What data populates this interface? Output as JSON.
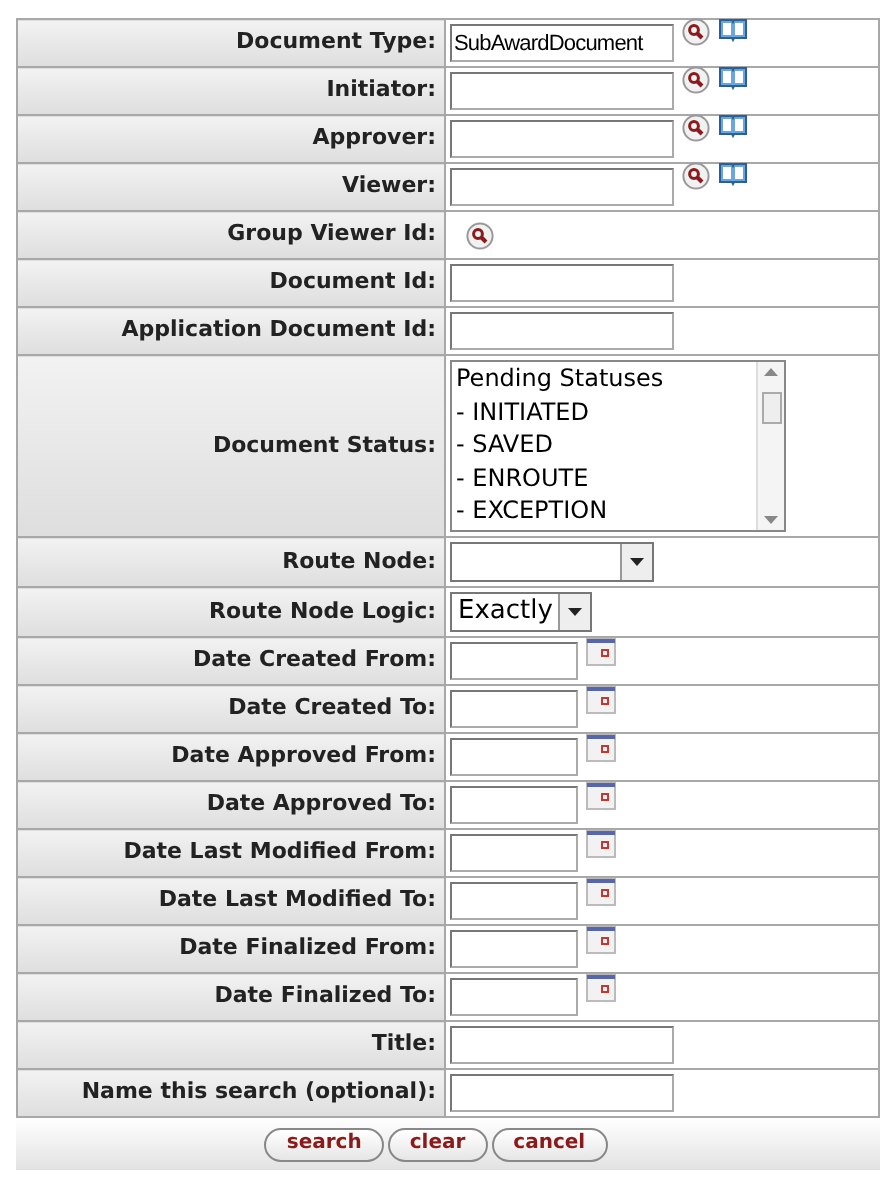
{
  "fields": [
    {
      "kind": "lookup_text",
      "label": "Document Type:",
      "value": "SubAwardDocument"
    },
    {
      "kind": "lookup_text",
      "label": "Initiator:"
    },
    {
      "kind": "lookup_text",
      "label": "Approver:"
    },
    {
      "kind": "lookup_text",
      "label": "Viewer:"
    },
    {
      "kind": "lookup",
      "label": "Group Viewer Id:"
    },
    {
      "kind": "text",
      "label": "Document Id:"
    },
    {
      "kind": "text",
      "label": "Application Document Id:"
    },
    {
      "kind": "listbox",
      "label": "Document Status:",
      "options": [
        "Pending Statuses",
        "- INITIATED",
        "- SAVED",
        "- ENROUTE",
        "- EXCEPTION"
      ]
    },
    {
      "kind": "select",
      "label": "Route Node:"
    },
    {
      "kind": "select",
      "label": "Route Node Logic:",
      "value": "Exactly"
    },
    {
      "kind": "date",
      "label": "Date Created From:"
    },
    {
      "kind": "date",
      "label": "Date Created To:"
    },
    {
      "kind": "date",
      "label": "Date Approved From:"
    },
    {
      "kind": "date",
      "label": "Date Approved To:"
    },
    {
      "kind": "date",
      "label": "Date Last Modified From:"
    },
    {
      "kind": "date",
      "label": "Date Last Modified To:"
    },
    {
      "kind": "date",
      "label": "Date Finalized From:"
    },
    {
      "kind": "date",
      "label": "Date Finalized To:"
    },
    {
      "kind": "text",
      "label": "Title:"
    },
    {
      "kind": "text",
      "label": "Name this search (optional):"
    }
  ],
  "buttons": [
    "search",
    "clear",
    "cancel"
  ]
}
